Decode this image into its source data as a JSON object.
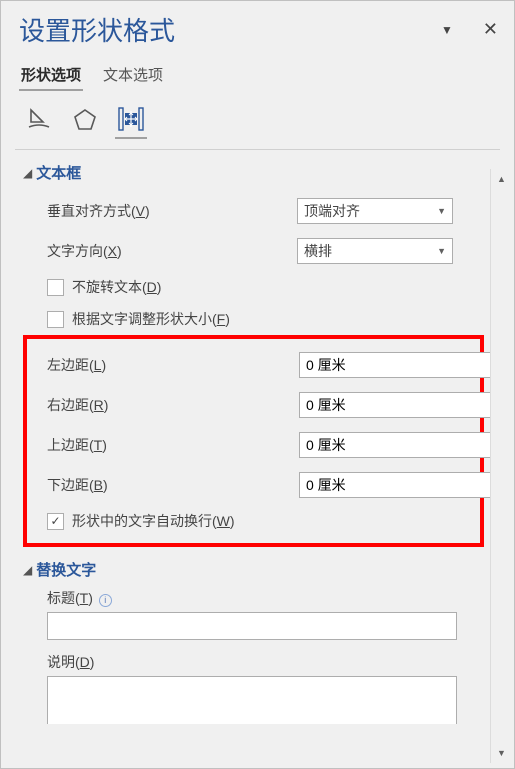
{
  "pane": {
    "title": "设置形状格式"
  },
  "tabs": {
    "shape_options": "形状选项",
    "text_options": "文本选项"
  },
  "sections": {
    "textbox": {
      "title": "文本框",
      "valign_label": "垂直对齐方式(V)",
      "valign_value": "顶端对齐",
      "direction_label": "文字方向(X)",
      "direction_value": "横排",
      "no_rotate": "不旋转文本(D)",
      "autosize": "根据文字调整形状大小(F)",
      "left_margin_label": "左边距(L)",
      "left_margin_value": "0 厘米",
      "right_margin_label": "右边距(R)",
      "right_margin_value": "0 厘米",
      "top_margin_label": "上边距(T)",
      "top_margin_value": "0 厘米",
      "bottom_margin_label": "下边距(B)",
      "bottom_margin_value": "0 厘米",
      "wrap": "形状中的文字自动换行(W)"
    },
    "alttext": {
      "title": "替换文字",
      "title_label": "标题(T)",
      "desc_label": "说明(D)"
    }
  }
}
